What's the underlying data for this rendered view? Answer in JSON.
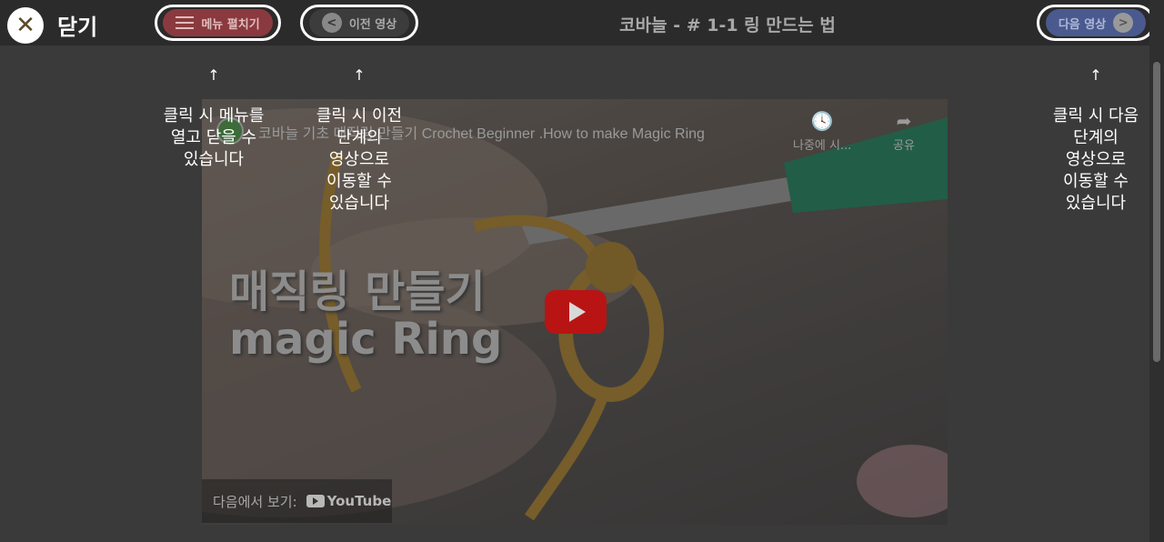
{
  "header": {
    "close_icon": "close-icon",
    "close_label": "닫기",
    "menu_button_label": "메뉴 펼치기",
    "prev_button_label": "이전 영상",
    "prev_symbol": "<",
    "title": "코바늘 - # 1-1 링 만드는 법",
    "next_button_label": "다음 영상",
    "next_symbol": ">"
  },
  "hints": {
    "arrow": "↑",
    "menu": "클릭 시 메뉴를\n열고 닫을 수\n있습니다",
    "prev": "클릭 시 이전\n단계의\n영상으로\n이동할 수\n있습니다",
    "next": "클릭 시 다음\n단계의\n영상으로\n이동할 수\n있습니다"
  },
  "video": {
    "title": "코바늘 기초 매직링 만들기 Crochet Beginner .How to make Magic Ring",
    "watch_later_label": "나중에 시...",
    "share_label": "공유",
    "overlay_line1": "매직링 만들기",
    "overlay_line2": "magic Ring",
    "watch_on_label": "다음에서 보기:",
    "youtube_logo_text": "YouTube"
  },
  "colors": {
    "menu_button": "#8a3a3e",
    "next_button": "#4a5a8e",
    "play_button": "#b81414",
    "topbar": "#2b2b2b",
    "background": "#3a3a3a"
  }
}
